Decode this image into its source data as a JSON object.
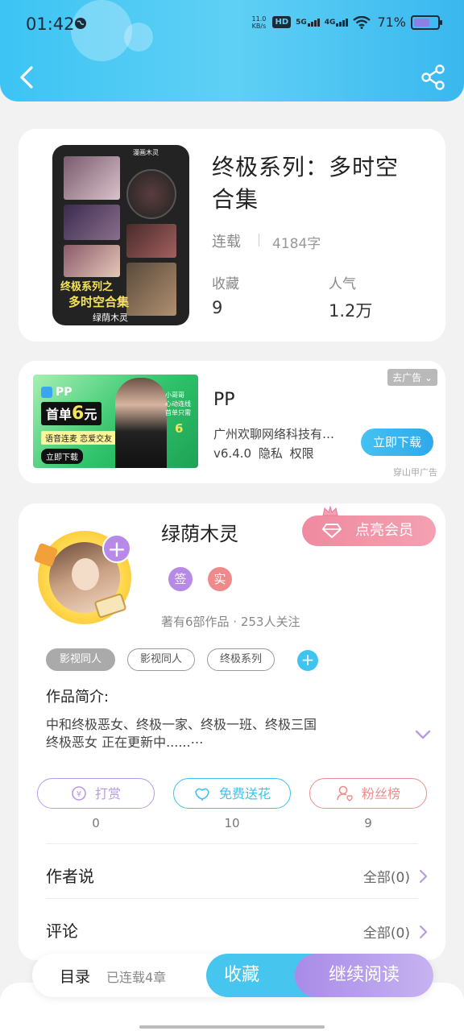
{
  "status_bar": {
    "time": "01:42",
    "net_speed_value": "11.0",
    "net_speed_unit": "KB/s",
    "hd_label": "HD",
    "signal_1_label": "5G",
    "signal_2_label": "4G",
    "battery_percent": "71%",
    "battery_level": 0.71
  },
  "header": {
    "back_icon": "chevron-left-icon",
    "share_icon": "share-icon",
    "color_accent": "#3cc4f4"
  },
  "book": {
    "title": "终极系列：多时空合集",
    "status": "连载",
    "word_count": "4184字",
    "cover": {
      "title_line1": "终极系列之",
      "title_line2": "多时空合集",
      "author": "绿荫木灵",
      "tag": "漫画木灵"
    },
    "stats": [
      {
        "label": "收藏",
        "value": "9"
      },
      {
        "label": "人气",
        "value": "1.2万"
      }
    ]
  },
  "ad": {
    "close_label": "去广告",
    "app_name": "PP",
    "company": "广州欢聊网络科技有…",
    "version": "v6.4.0",
    "privacy": "隐私",
    "permission": "权限",
    "download_label": "立即下载",
    "source": "穿山甲广告",
    "banner": {
      "brand": "PP",
      "price_prefix": "首单",
      "price_value": "6",
      "price_unit": "元",
      "slogan": "语音连麦  恋爱交友",
      "cta": "立即下载",
      "side_text": "小哥哥\n心动连线\n首单只需",
      "side_value": "6"
    }
  },
  "author": {
    "name": "绿荫木灵",
    "vip_label": "点亮会员",
    "badges": [
      {
        "label": "签",
        "color": "#b78ae6"
      },
      {
        "label": "实",
        "color": "#f08a8a"
      }
    ],
    "stats_text": "著有6部作品 · 253人关注",
    "tags": [
      {
        "label": "影视同人",
        "filled": true
      },
      {
        "label": "影视同人",
        "filled": false
      },
      {
        "label": "终极系列",
        "filled": false
      }
    ],
    "intro_label": "作品简介:",
    "intro_line1": "中和终极恶女、终极一家、终极一班、终极三国",
    "intro_line2": "终极恶女    正在更新中......⋯",
    "actions": [
      {
        "label": "打赏",
        "count": "0",
        "color": "#b79be6",
        "icon": "coin-icon"
      },
      {
        "label": "免费送花",
        "count": "10",
        "color": "#3cc4ee",
        "icon": "flower-icon"
      },
      {
        "label": "粉丝榜",
        "count": "9",
        "color": "#ef8d8d",
        "icon": "fan-icon"
      }
    ],
    "author_says_label": "作者说",
    "author_says_all": "全部(0)",
    "comments_label": "评论",
    "comments_all": "全部(0)"
  },
  "bottom_bar": {
    "toc_label": "目录",
    "toc_count": "已连载4章",
    "fav_label": "收藏",
    "read_label": "继续阅读"
  }
}
